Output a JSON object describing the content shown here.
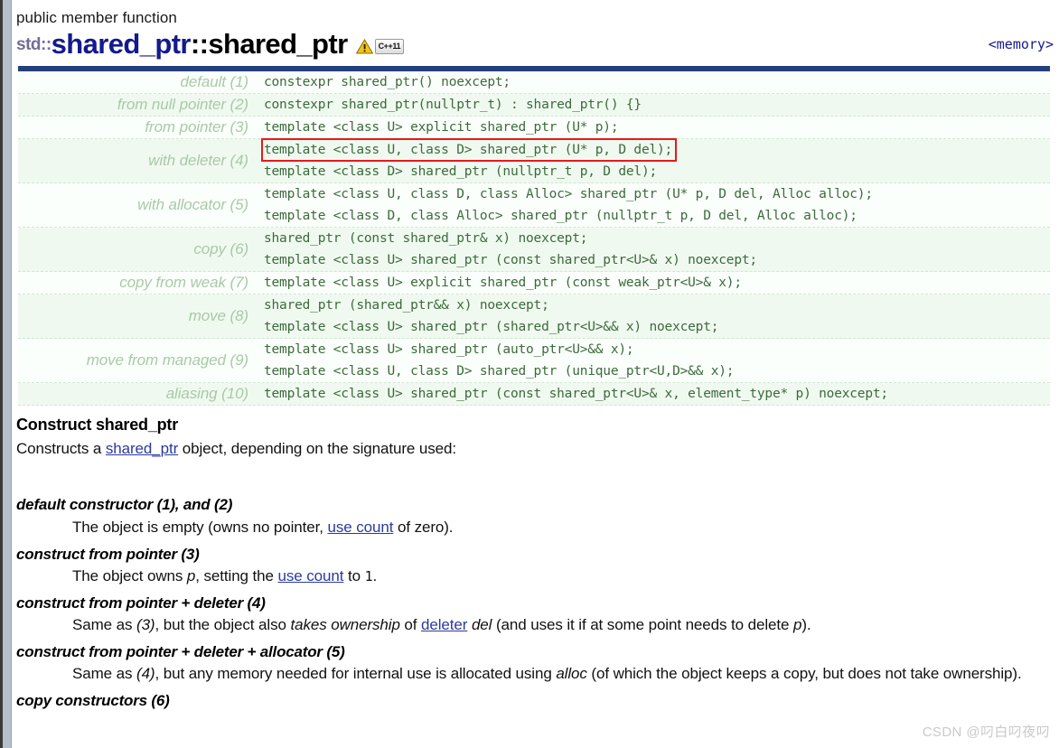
{
  "header": {
    "kicker": "public member function",
    "namespace": "std::",
    "title_main": "shared_ptr",
    "title_sep": "::",
    "title_tail": "shared_ptr",
    "badge_cpp": "C++11",
    "warning_icon": "warning-triangle-icon",
    "include_header": "<memory>",
    "colors": {
      "title_main": "#141a8c",
      "namespace": "#6f6f97",
      "table_header_bar": "#23407c",
      "code_text": "#3c6a3c",
      "label_text": "#a9c9a9",
      "link": "#2b3a9e",
      "highlight_box": "#e8191b"
    }
  },
  "signatures": [
    {
      "label": "default (1)",
      "codes": [
        {
          "text": "constexpr shared_ptr() noexcept;",
          "highlighted": false
        }
      ]
    },
    {
      "label": "from null pointer (2)",
      "codes": [
        {
          "text": "constexpr shared_ptr(nullptr_t) : shared_ptr() {}",
          "highlighted": false
        }
      ]
    },
    {
      "label": "from pointer (3)",
      "codes": [
        {
          "text": "template <class U> explicit shared_ptr (U* p);",
          "highlighted": false
        }
      ]
    },
    {
      "label": "with deleter (4)",
      "codes": [
        {
          "text": "template <class U, class D> shared_ptr (U* p, D del);",
          "highlighted": true
        },
        {
          "text": "template <class D> shared_ptr (nullptr_t p, D del);",
          "highlighted": false
        }
      ]
    },
    {
      "label": "with allocator (5)",
      "codes": [
        {
          "text": "template <class U, class D, class Alloc> shared_ptr (U* p, D del, Alloc alloc);",
          "highlighted": false
        },
        {
          "text": "template <class D, class Alloc> shared_ptr (nullptr_t p, D del, Alloc alloc);",
          "highlighted": false
        }
      ]
    },
    {
      "label": "copy (6)",
      "codes": [
        {
          "text": "shared_ptr (const shared_ptr& x) noexcept;",
          "highlighted": false
        },
        {
          "text": "template <class U> shared_ptr (const shared_ptr<U>& x) noexcept;",
          "highlighted": false
        }
      ]
    },
    {
      "label": "copy from weak (7)",
      "codes": [
        {
          "text": "template <class U> explicit shared_ptr (const weak_ptr<U>& x);",
          "highlighted": false
        }
      ]
    },
    {
      "label": "move (8)",
      "codes": [
        {
          "text": "shared_ptr (shared_ptr&& x) noexcept;",
          "highlighted": false
        },
        {
          "text": "template <class U> shared_ptr (shared_ptr<U>&& x) noexcept;",
          "highlighted": false
        }
      ]
    },
    {
      "label": "move from managed (9)",
      "codes": [
        {
          "text": "template <class U> shared_ptr (auto_ptr<U>&& x);",
          "highlighted": false
        },
        {
          "text": "template <class U, class D> shared_ptr (unique_ptr<U,D>&& x);",
          "highlighted": false
        }
      ]
    },
    {
      "label": "aliasing (10)",
      "codes": [
        {
          "text": "template <class U> shared_ptr (const shared_ptr<U>& x, element_type* p) noexcept;",
          "highlighted": false
        }
      ]
    }
  ],
  "body": {
    "section_title": "Construct shared_ptr",
    "intro": {
      "before": "Constructs a ",
      "link": "shared_ptr",
      "after": " object, depending on the signature used:"
    },
    "entries": [
      {
        "term": "default constructor (1), and (2)",
        "desc_parts": [
          {
            "text": "The object is empty (owns no pointer, ",
            "style": "plain"
          },
          {
            "text": "use count",
            "style": "link"
          },
          {
            "text": " of zero).",
            "style": "plain"
          }
        ]
      },
      {
        "term": "construct from pointer (3)",
        "desc_parts": [
          {
            "text": "The object owns ",
            "style": "plain"
          },
          {
            "text": "p",
            "style": "italic"
          },
          {
            "text": ", setting the ",
            "style": "plain"
          },
          {
            "text": "use count",
            "style": "link"
          },
          {
            "text": " to ",
            "style": "plain"
          },
          {
            "text": "1",
            "style": "mono"
          },
          {
            "text": ".",
            "style": "plain"
          }
        ]
      },
      {
        "term": "construct from pointer + deleter (4)",
        "desc_parts": [
          {
            "text": "Same as ",
            "style": "plain"
          },
          {
            "text": "(3)",
            "style": "italic"
          },
          {
            "text": ", but the object also ",
            "style": "plain"
          },
          {
            "text": "takes ownership",
            "style": "italic"
          },
          {
            "text": " of ",
            "style": "plain"
          },
          {
            "text": "deleter",
            "style": "link"
          },
          {
            "text": " ",
            "style": "plain"
          },
          {
            "text": "del",
            "style": "italic"
          },
          {
            "text": " (and uses it if at some point needs to delete ",
            "style": "plain"
          },
          {
            "text": "p",
            "style": "italic"
          },
          {
            "text": ").",
            "style": "plain"
          }
        ]
      },
      {
        "term": "construct from pointer + deleter + allocator (5)",
        "desc_parts": [
          {
            "text": "Same as ",
            "style": "plain"
          },
          {
            "text": "(4)",
            "style": "italic"
          },
          {
            "text": ", but any memory needed for internal use is allocated using ",
            "style": "plain"
          },
          {
            "text": "alloc",
            "style": "italic"
          },
          {
            "text": " (of which the object keeps a copy, but does not take ownership).",
            "style": "plain"
          }
        ]
      },
      {
        "term": "copy constructors (6)",
        "desc_parts": []
      }
    ]
  },
  "watermark": "CSDN @叼白叼夜叼"
}
